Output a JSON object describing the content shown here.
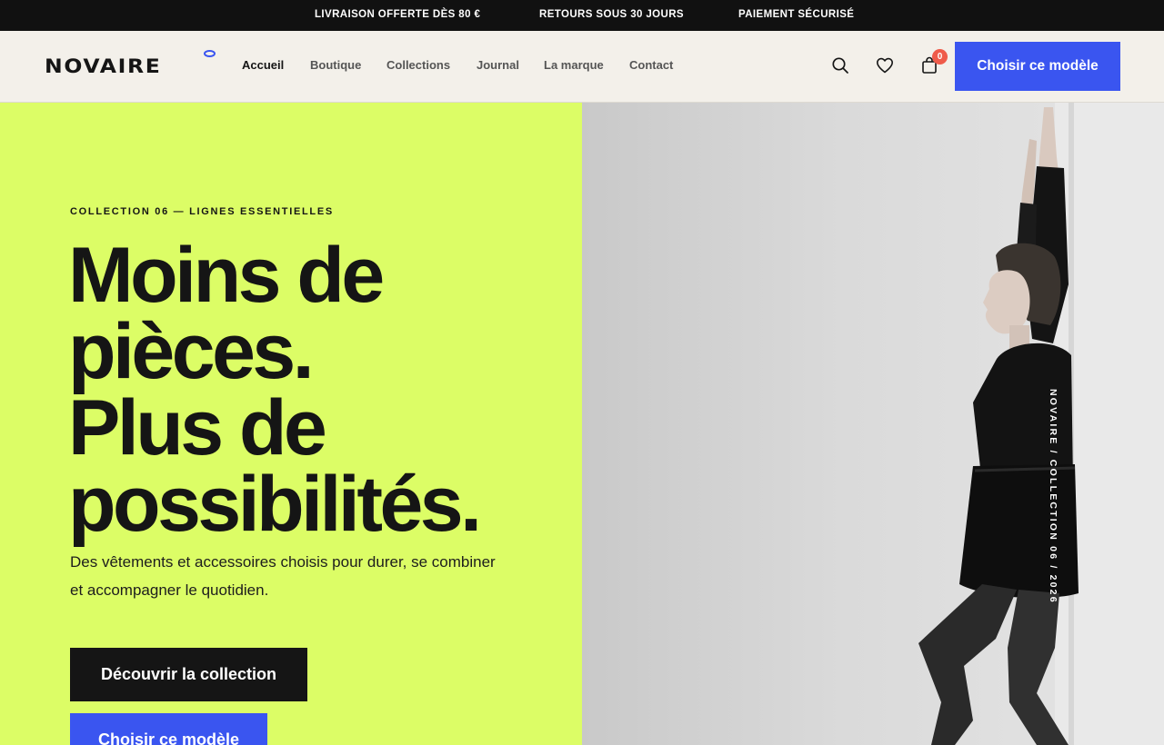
{
  "announcement": {
    "items": [
      "LIVRAISON OFFERTE DÈS 80 €",
      "RETOURS SOUS 30 JOURS",
      "PAIEMENT SÉCURISÉ"
    ]
  },
  "header": {
    "logo": "NOVAIRE",
    "nav": [
      "Accueil",
      "Boutique",
      "Collections",
      "Journal",
      "La marque",
      "Contact"
    ],
    "active_nav": "Accueil",
    "cart_count": "0",
    "cta_label": "Choisir ce modèle",
    "icons": [
      "search-icon",
      "heart-icon",
      "bag-icon"
    ]
  },
  "hero": {
    "eyebrow": "COLLECTION 06 — LIGNES ESSENTIELLES",
    "headline_lines": [
      "Moins de",
      "pièces.",
      "Plus de",
      "possibilités."
    ],
    "subtitle": "Des vêtements et accessoires choisis pour durer, se combiner et accompagner le quotidien.",
    "primary_cta": "Découvrir la collection",
    "secondary_cta": "Choisir ce modèle",
    "image_caption": "NOVAIRE / COLLECTION 06 / 2026"
  },
  "colors": {
    "accent_blue": "#3a55f0",
    "hero_green": "#dcfd66",
    "ink": "#151515",
    "badge_red": "#ef5b4a",
    "topbar": "#111111"
  }
}
